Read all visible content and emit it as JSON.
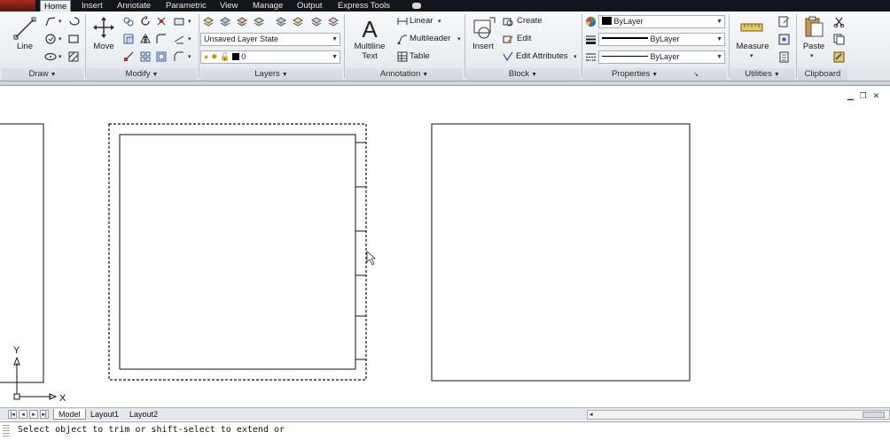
{
  "tabs": [
    "Home",
    "Insert",
    "Annotate",
    "Parametric",
    "View",
    "Manage",
    "Output",
    "Express Tools"
  ],
  "ribbon": {
    "groups": [
      "Draw",
      "Modify",
      "Layers",
      "Annotation",
      "Block",
      "Properties",
      "Utilities",
      "Clipboard"
    ],
    "draw": {
      "line_label": "Line"
    },
    "modify": {
      "move_label": "Move"
    },
    "layers": {
      "layer_state": "Unsaved Layer State",
      "current_layer": "0"
    },
    "annotation": {
      "text_label_1": "Multiline",
      "text_label_2": "Text",
      "linear_label": "Linear",
      "multileader_label": "Multileader",
      "table_label": "Table"
    },
    "block": {
      "insert_label": "Insert",
      "create_label": "Create",
      "edit_label": "Edit",
      "edit_attributes_label": "Edit Attributes"
    },
    "properties": {
      "color": "ByLayer",
      "linetype": "ByLayer",
      "lineweight": "ByLayer"
    },
    "utilities": {
      "measure_label": "Measure"
    },
    "clipboard": {
      "paste_label": "Paste"
    }
  },
  "ucs": {
    "x_label": "X",
    "y_label": "Y"
  },
  "layout_tabs": [
    "Model",
    "Layout1",
    "Layout2"
  ],
  "command_line": "Select object to trim or shift-select to extend or",
  "colors": {
    "tab_bar": "#12151c",
    "app_button": "#a52a1f",
    "ribbon_bg": "#e9edf2",
    "canvas_bg": "#ffffff"
  }
}
